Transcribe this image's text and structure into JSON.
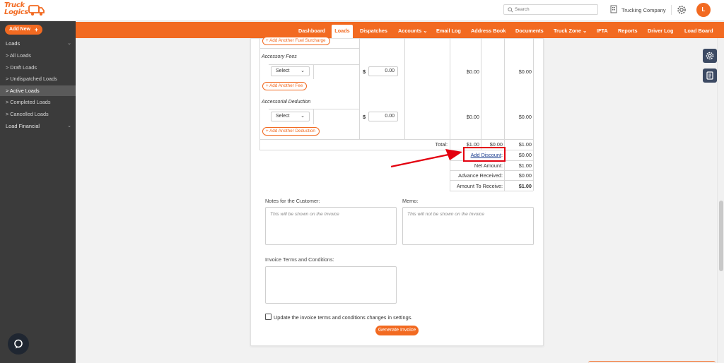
{
  "header": {
    "logo_line1": "Truck",
    "logo_line2": "Logics",
    "search_placeholder": "Search",
    "company": "Trucking Company",
    "avatar_initial": "L"
  },
  "nav": {
    "items": [
      "Dashboard",
      "Loads",
      "Dispatches",
      "Accounts ⌄",
      "Email Log",
      "Address Book",
      "Documents",
      "Truck Zone ⌄",
      "IFTA",
      "Reports",
      "Driver Log",
      "Load Board"
    ],
    "active": "Loads"
  },
  "sidebar": {
    "add_new": "Add New",
    "add_new_plus": "+",
    "loads_section": "Loads",
    "items": [
      "> All Loads",
      "> Draft Loads",
      "> Undispatched Loads",
      "> Active Loads",
      "> Completed Loads",
      "> Cancelled Loads"
    ],
    "financial_section": "Load Financial"
  },
  "invoice": {
    "add_fuel_surcharge": "+ Add Another Fuel Surcharge",
    "accessory_fees_title": "Accessory Fees",
    "fee_select": "Select",
    "fee_amount": "0.00",
    "fee_rate": "$0.00",
    "fee_total": "$0.00",
    "add_fee": "+ Add Another Fee",
    "accessorial_deduction_title": "Accessorial Deduction",
    "deduction_select": "Select",
    "deduction_amount": "0.00",
    "deduction_rate": "$0.00",
    "deduction_total": "$0.00",
    "add_deduction": "+ Add Another Deduction",
    "currency": "$",
    "total_label": "Total:",
    "total_a": "$1.00",
    "total_b": "$0.00",
    "total_c": "$1.00",
    "add_discount_label": "Add Discount",
    "add_discount_value": "$0.00",
    "net_amount_label": "Net Amount:",
    "net_amount_value": "$1.00",
    "advance_received_label": "Advance Received:",
    "advance_received_value": "$0.00",
    "amount_to_receive_label": "Amount To Receive:",
    "amount_to_receive_value": "$1.00"
  },
  "notes": {
    "customer_label": "Notes for the Customer:",
    "customer_placeholder": "This will be shown on the Invoice",
    "memo_label": "Memo:",
    "memo_placeholder": "This will not be shown on the Invoice",
    "terms_label": "Invoice Terms and Conditions:",
    "update_terms_label": "Update the invoice terms and conditions changes in settings.",
    "generate_button": "Generate Invoice"
  },
  "colors": {
    "brand": "#f26a21",
    "sidebar": "#3b3b3b",
    "highlight": "#e3000f"
  },
  "icons": [
    "search-icon",
    "building-icon",
    "gear-icon",
    "chat-icon",
    "settings-tool-icon",
    "document-tool-icon",
    "arrow-annotation"
  ]
}
